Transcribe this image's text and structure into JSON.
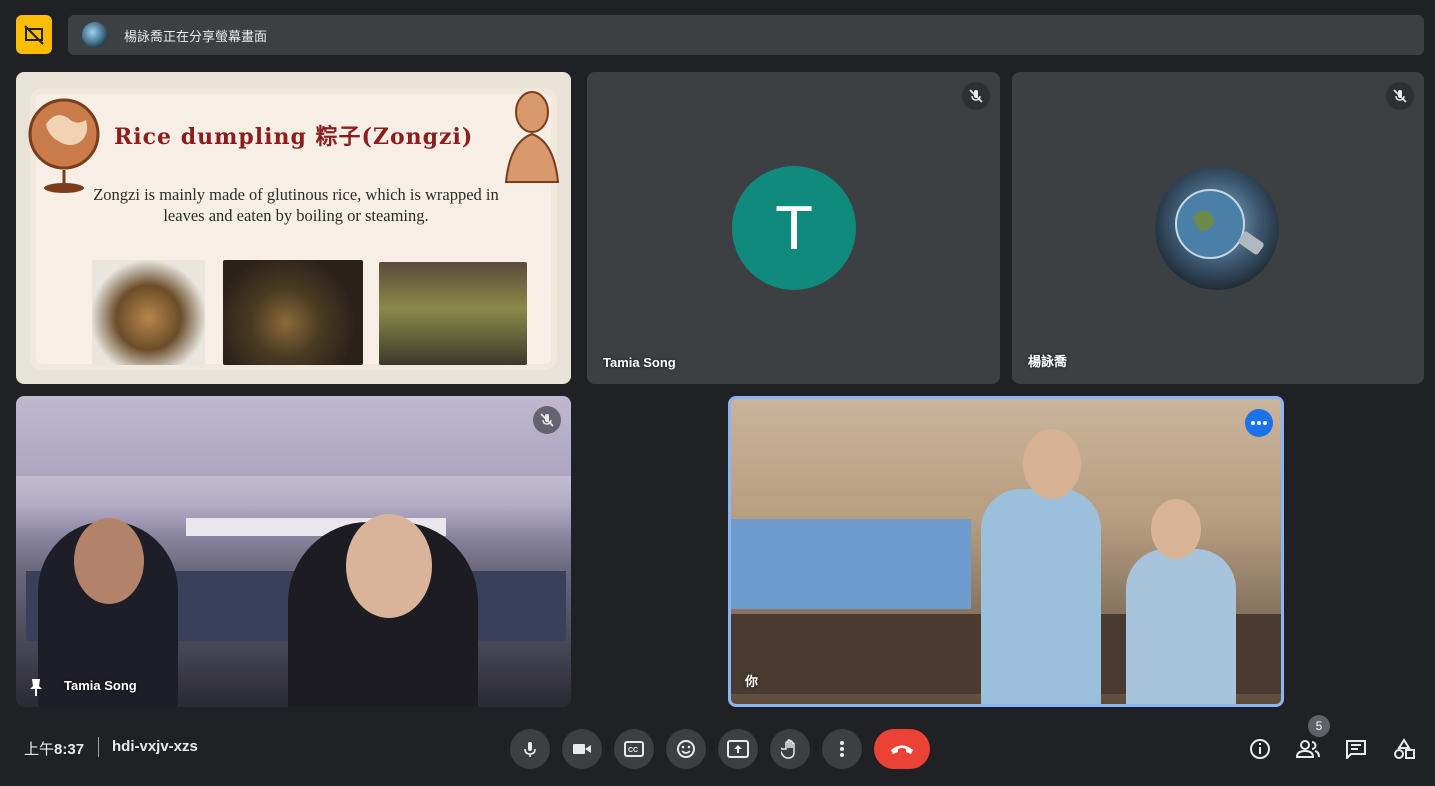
{
  "banner": {
    "text": "楊詠喬正在分享螢幕畫面"
  },
  "slide": {
    "title": "Rice dumpling 粽子(Zongzi)",
    "body": "Zongzi is mainly made of glutinous rice, which is wrapped in leaves and eaten by boiling or steaming."
  },
  "tiles": {
    "tamia_avatar": {
      "name": "Tamia Song",
      "initial": "T"
    },
    "yang": {
      "name": "楊詠喬"
    },
    "classroom": {
      "name": "Tamia Song"
    },
    "self": {
      "name": "你"
    }
  },
  "footer": {
    "time_prefix": "上午",
    "time": "8:37",
    "meeting_code": "hdi-vxjv-xzs"
  },
  "people_count": "5",
  "colors": {
    "background": "#202124",
    "tile": "#3c4043",
    "end_call": "#ea4335",
    "accent_border": "#8ab4f8",
    "avatar_teal": "#0f8a7d",
    "present_yellow": "#fbbc04"
  }
}
